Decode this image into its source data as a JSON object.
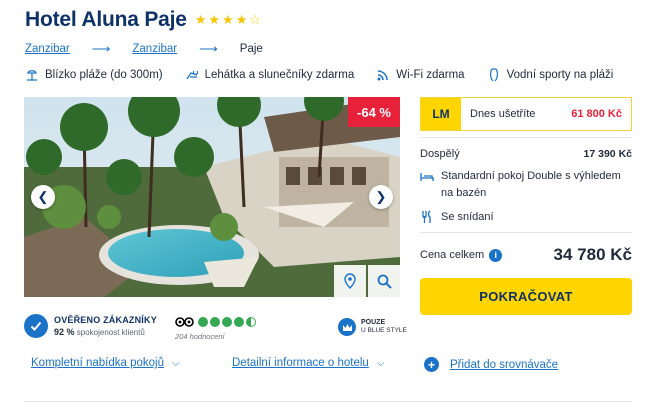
{
  "hotel": {
    "name": "Hotel Aluna Paje",
    "stars": 4,
    "max_stars": 5
  },
  "breadcrumb": [
    {
      "label": "Zanzibar",
      "link": true
    },
    {
      "label": "Zanzibar",
      "link": true
    },
    {
      "label": "Paje",
      "link": false
    }
  ],
  "features": [
    {
      "icon": "beach-icon",
      "label": "Blízko pláže (do 300m)"
    },
    {
      "icon": "sunbed-icon",
      "label": "Lehátka a slunečníky zdarma"
    },
    {
      "icon": "wifi-icon",
      "label": "Wi-Fi zdarma"
    },
    {
      "icon": "water-sports-icon",
      "label": "Vodní sporty na pláži"
    }
  ],
  "gallery": {
    "discount": "-64 %"
  },
  "verified": {
    "title": "OVĚŘENO ZÁKAZNÍKY",
    "percent": "92 %",
    "subtitle": "spokojenost klientů"
  },
  "tripadvisor": {
    "rating": 4.5,
    "reviews": "204 hodnocení"
  },
  "exclusive": {
    "line1": "POUZE",
    "line2": "U BLUE STYLE"
  },
  "price": {
    "lm_badge": "LM",
    "savings_label": "Dnes ušetříte",
    "savings_amount": "61 800 Kč",
    "adult_label": "Dospělý",
    "adult_price": "17 390 Kč",
    "room_line1": "Standardní pokoj Double s výhledem",
    "room_line2": "na bazén",
    "meal": "Se snídaní",
    "total_label": "Cena celkem",
    "total_price": "34 780 Kč",
    "continue_label": "POKRAČOVAT"
  },
  "bottom": {
    "rooms_link": "Kompletní nabídka pokojů",
    "details_link": "Detailní informace o hotelu",
    "compare_link": "Přidat do srovnávače"
  },
  "colors": {
    "brand_blue": "#0e3268",
    "link_blue": "#1a73c7",
    "accent_yellow": "#ffd500",
    "discount_red": "#e8213a",
    "rating_green": "#34a853"
  }
}
